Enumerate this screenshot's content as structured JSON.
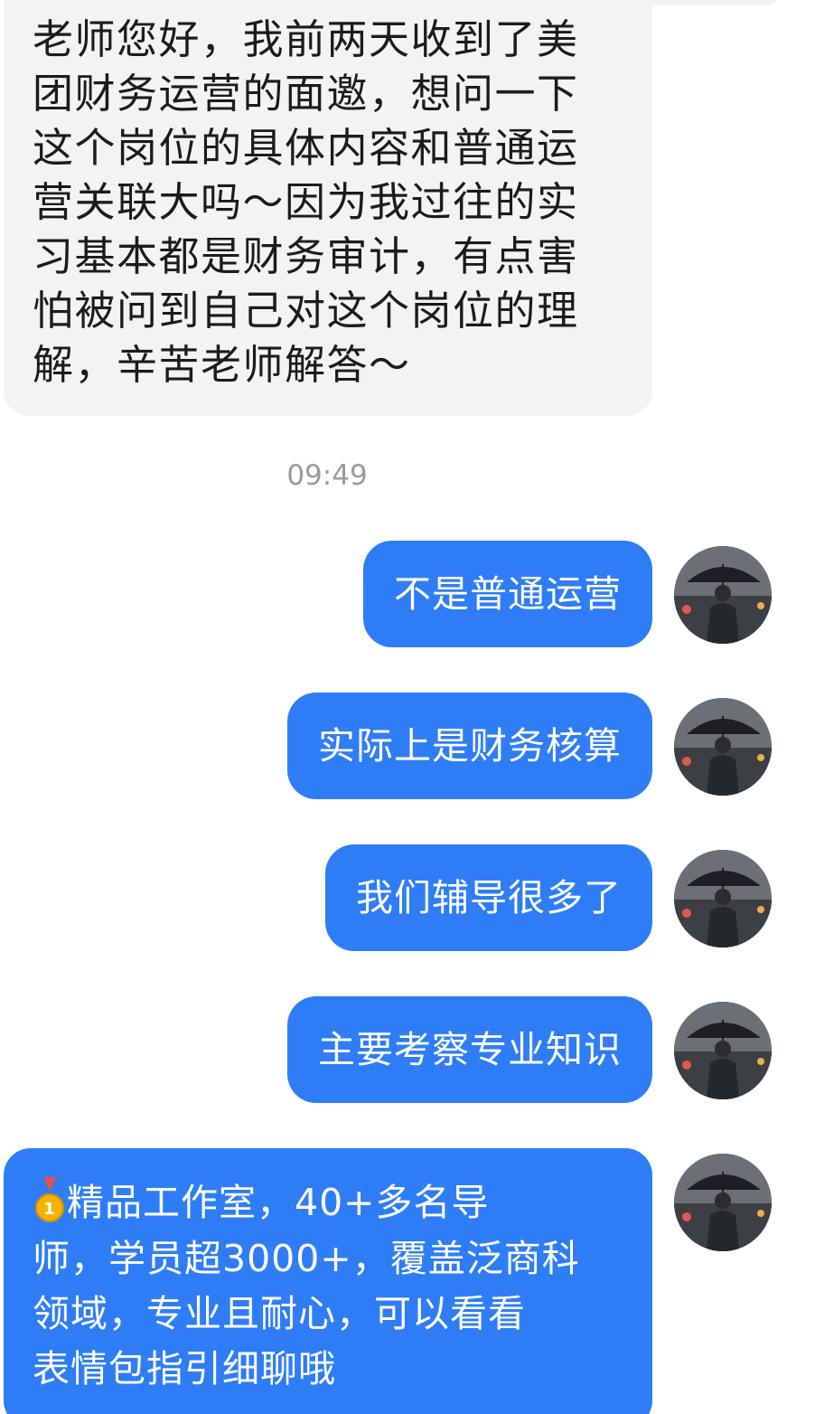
{
  "incoming_message": {
    "lines": [
      "老师您好，我前两天收到了美",
      "团财务运营的面邀，想问一下",
      "这个岗位的具体内容和普通运",
      "营关联大吗～因为我过往的实",
      "习基本都是财务审计，有点害",
      "怕被问到自己对这个岗位的理",
      "解，辛苦老师解答～"
    ]
  },
  "timestamp": "09:49",
  "outgoing_messages": [
    {
      "text": "不是普通运营"
    },
    {
      "text": "实际上是财务核算"
    },
    {
      "text": "我们辅导很多了"
    },
    {
      "text": "主要考察专业知识"
    },
    {
      "icon": "medal-icon",
      "lines": [
        "精品工作室，40+多名导",
        "师，学员超3000+，覆盖泛商科",
        "领域，专业且耐心，可以看看",
        "表情包指引细聊哦"
      ]
    }
  ],
  "colors": {
    "outgoing_bubble": "#2f7df6",
    "incoming_bubble": "#f3f3f4",
    "timestamp": "#9a9a9a"
  }
}
